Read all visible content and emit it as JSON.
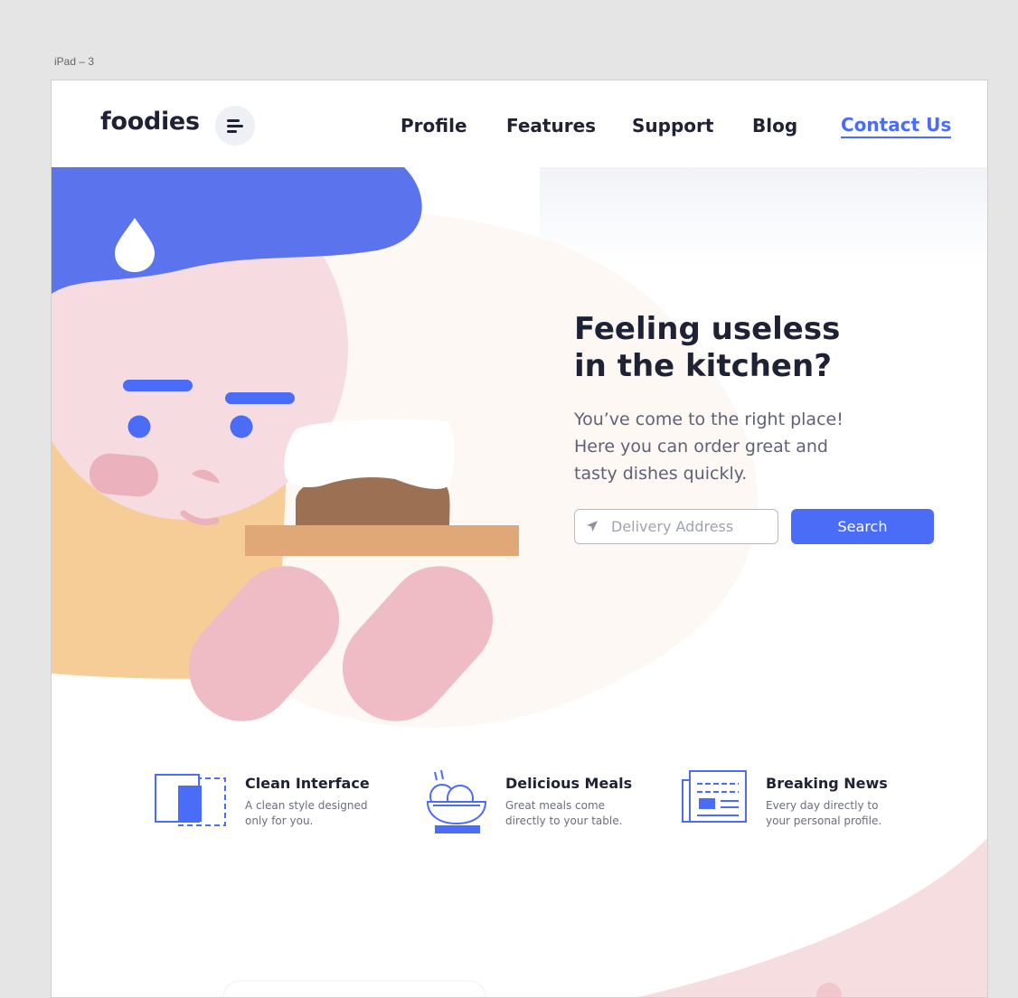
{
  "artboard": {
    "label": "iPad – 3"
  },
  "nav": {
    "logo": "foodies",
    "links": [
      {
        "label": "Profile"
      },
      {
        "label": "Features"
      },
      {
        "label": "Support"
      },
      {
        "label": "Blog"
      },
      {
        "label": "Contact Us",
        "active": true
      }
    ]
  },
  "hero": {
    "headline": "Feeling useless in the kitchen?",
    "subtext": "You’ve come to the right place! Here you can order great and tasty dishes quickly.",
    "address_placeholder": "Delivery Address",
    "search_label": "Search"
  },
  "features": [
    {
      "icon": "clean-interface-icon",
      "title": "Clean Interface",
      "desc": "A clean style designed only for you."
    },
    {
      "icon": "bowl-icon",
      "title": "Delicious Meals",
      "desc": "Great meals come directly to your table."
    },
    {
      "icon": "newspaper-icon",
      "title": "Breaking News",
      "desc": "Every day directly to your personal profile."
    }
  ],
  "colors": {
    "accent": "#4a6cf7",
    "text_dark": "#1f2135",
    "text_muted": "#5e6274",
    "skin": "#f6dbe0",
    "hair": "#5b73ec",
    "shirt": "#f6cd96",
    "arm": "#efbcc6",
    "tray": "#dfa876",
    "cake": "#9b7053"
  }
}
